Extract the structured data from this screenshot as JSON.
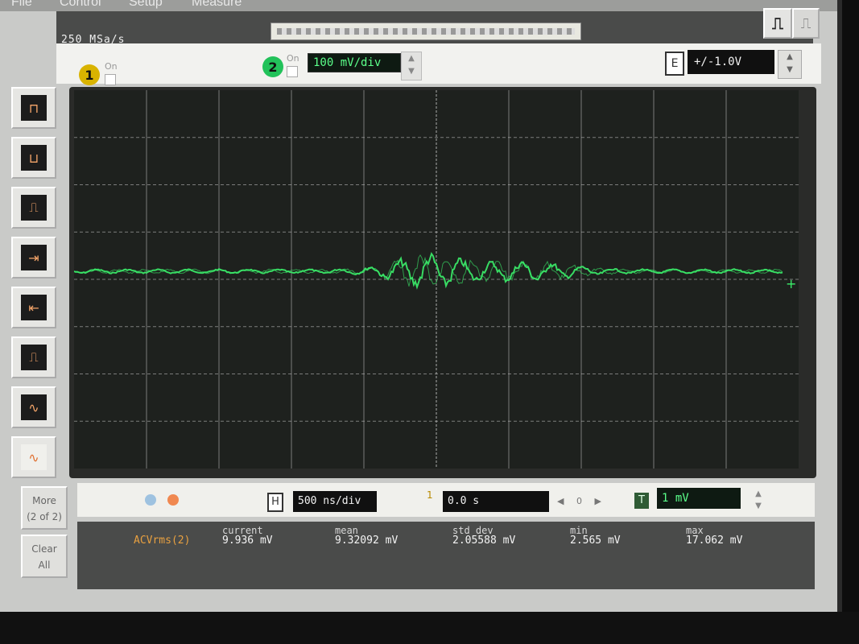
{
  "menu": [
    "File",
    "Control",
    "Setup",
    "Measure"
  ],
  "status": {
    "sample_rate": "250 MSa/s"
  },
  "channels": {
    "ch1": {
      "number": "1",
      "on_label": "On"
    },
    "ch2": {
      "number": "2",
      "on_label": "On",
      "scale": "100 mV/div"
    },
    "offset": "+/-1.0V",
    "offset_icon": "E"
  },
  "timebase": {
    "scale": "500 ns/div",
    "delay": "0.0 s",
    "delay_marker": "1",
    "nav": "◀ 0 ▶"
  },
  "trigger": {
    "level": "1 mV",
    "icon": "T"
  },
  "sidebar": {
    "more_label": "More",
    "more_sub": "(2 of 2)",
    "clear_label": "Clear",
    "clear_sub": "All"
  },
  "measurement": {
    "label": "ACVrms(2)",
    "columns": [
      {
        "head": "current",
        "value": "9.936 mV"
      },
      {
        "head": "mean",
        "value": "9.32092 mV"
      },
      {
        "head": "std dev",
        "value": "2.05588 mV"
      },
      {
        "head": "min",
        "value": "2.565 mV"
      },
      {
        "head": "max",
        "value": "17.062 mV"
      }
    ]
  },
  "colors": {
    "trace": "#3bf06a",
    "grid": "#c8c8c8",
    "screen_bg": "#1e211e"
  },
  "icons": [
    "rise-time-icon",
    "fall-time-icon",
    "period-icon",
    "delay-icon",
    "phase-icon",
    "pulse-icon",
    "sine-icon",
    "ac-rms-icon"
  ]
}
